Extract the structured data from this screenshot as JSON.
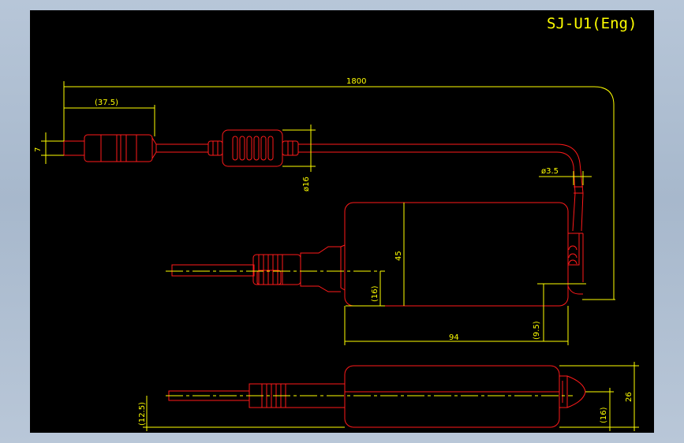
{
  "drawing": {
    "title": "SJ-U1(Eng)",
    "dimensions": {
      "overall_length": "1800",
      "dc_plug_length": "(37.5)",
      "dc_plug_dia": "7",
      "ferrite_dia": "ø16",
      "cable_dia": "ø3.5",
      "body_height": "45",
      "prong_offset": "(16)",
      "body_width": "94",
      "cable_offset": "(9.5)",
      "side_prong_offset": "(12.5)",
      "side_cable_offset": "(16)",
      "body_thickness": "26"
    }
  },
  "colors": {
    "outline": "#ff1a1a",
    "dimension": "#ffff00",
    "background": "#000000"
  }
}
